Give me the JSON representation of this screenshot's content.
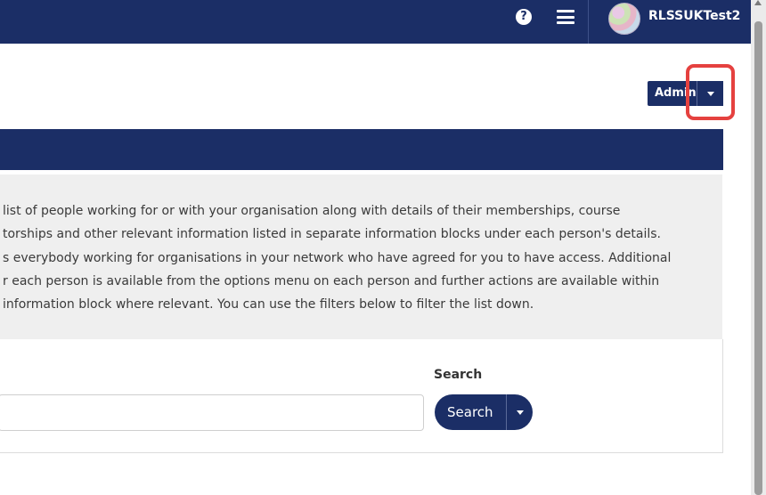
{
  "header": {
    "help_icon": "question-circle-icon",
    "help_glyph": "?",
    "menu_icon": "hamburger-menu-icon",
    "username": "RLSSUKTest2",
    "colors": {
      "navy": "#1b2e66",
      "highlight": "#e5413f"
    }
  },
  "actions": {
    "admin_label": "Admin",
    "admin_dropdown_icon": "caret-down-icon"
  },
  "info": {
    "lines": [
      "list of people working for or with your organisation along with details of their memberships, course",
      "torships and other relevant information listed in separate information blocks under each person's details.",
      "s everybody working for organisations in your network who have agreed for you to have access. Additional",
      "r each person is available from the options menu on each person and further actions are available within",
      " information block where relevant. You can use the filters below to filter the list down."
    ]
  },
  "search": {
    "label": "Search",
    "input_value": "",
    "button_label": "Search",
    "dropdown_icon": "caret-down-icon"
  }
}
